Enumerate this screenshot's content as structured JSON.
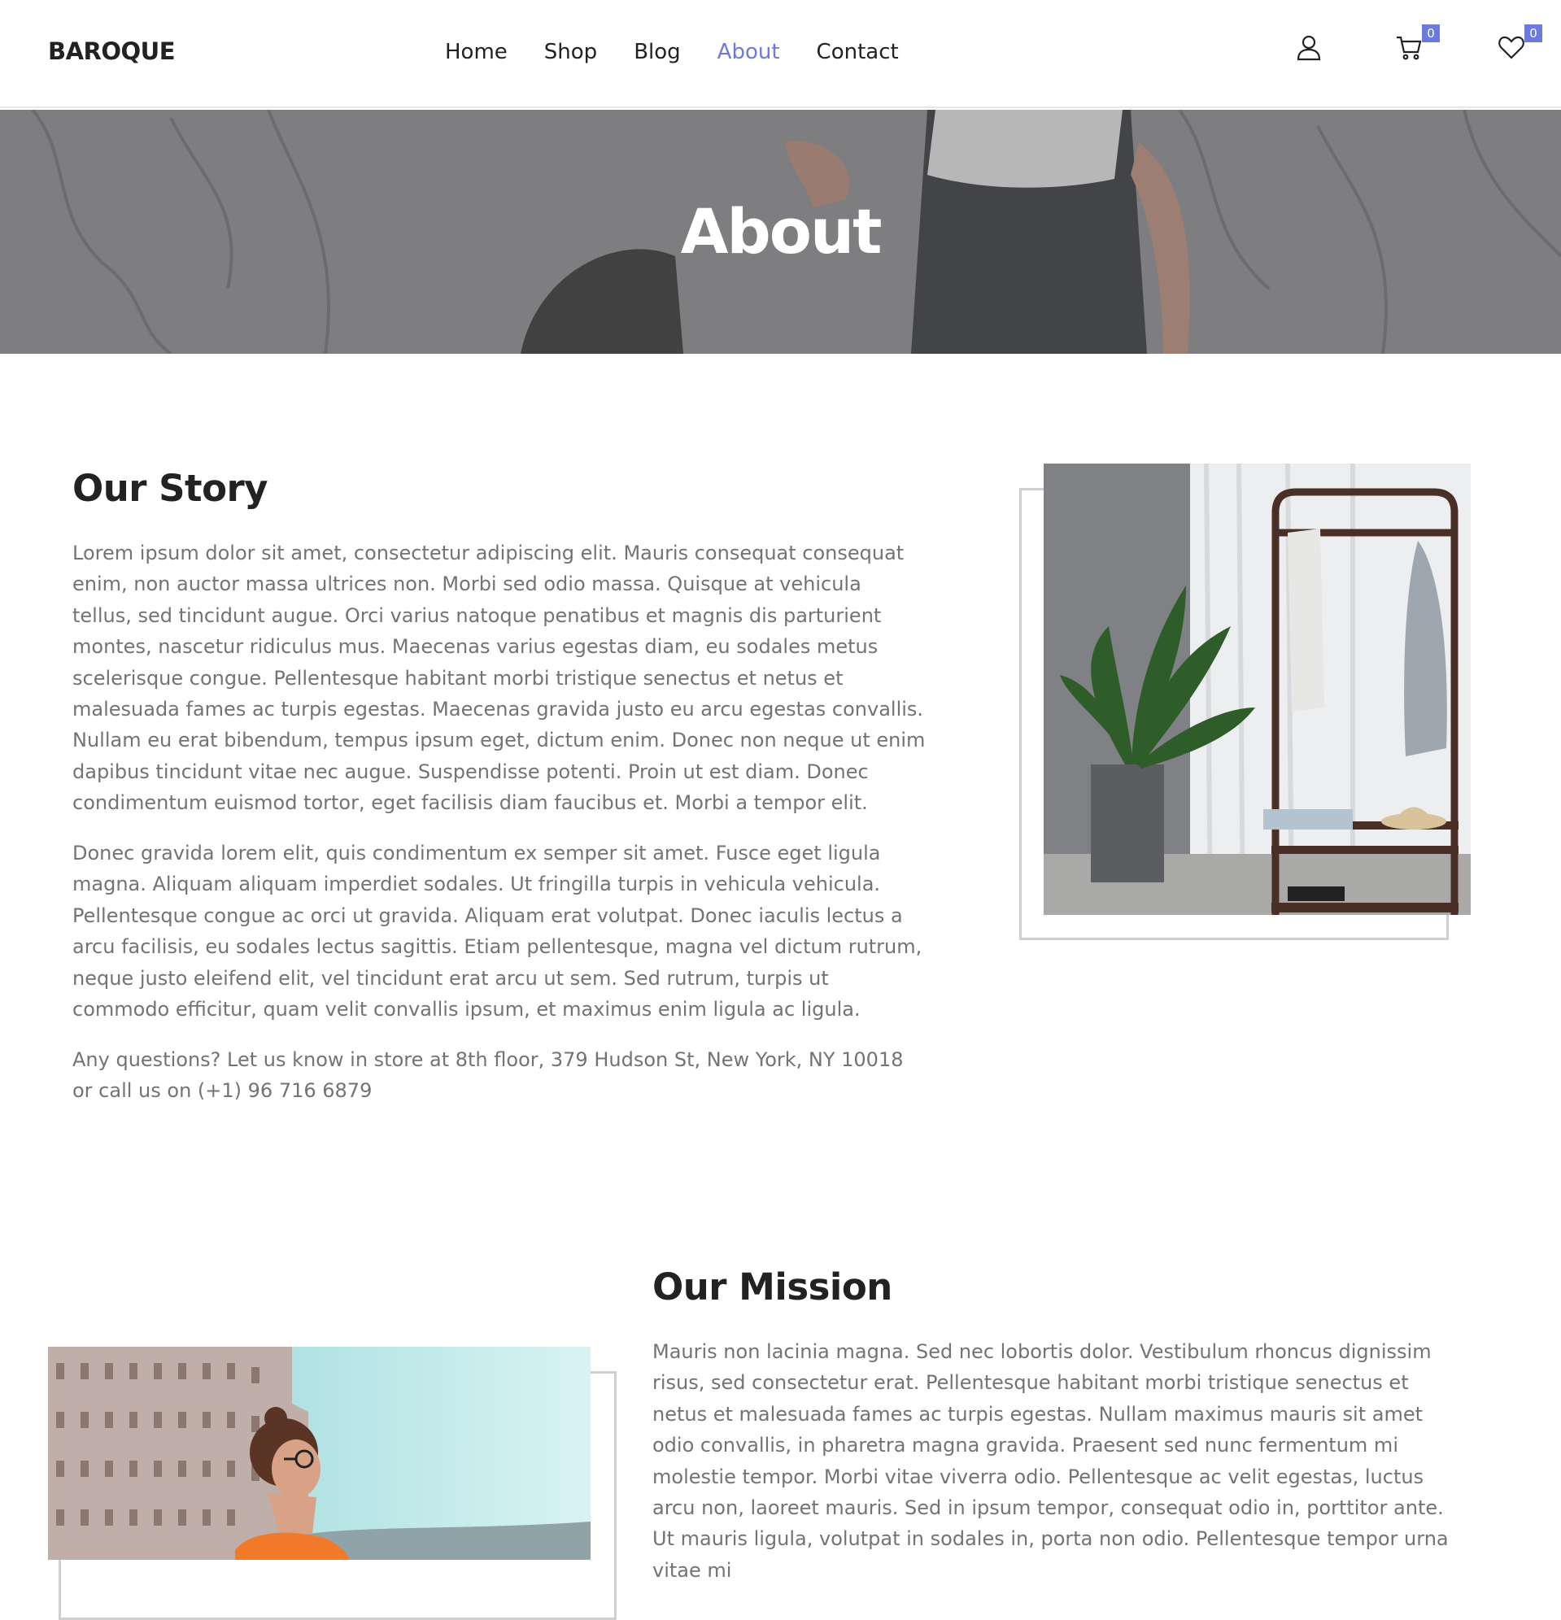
{
  "header": {
    "logo": "BAROQUE",
    "nav": [
      {
        "label": "Home",
        "active": false
      },
      {
        "label": "Shop",
        "active": false
      },
      {
        "label": "Blog",
        "active": false
      },
      {
        "label": "About",
        "active": true
      },
      {
        "label": "Contact",
        "active": false
      }
    ],
    "icons": {
      "account": "user-icon",
      "cart": "cart-icon",
      "wishlist": "heart-icon"
    },
    "cart_count": "0",
    "wishlist_count": "0"
  },
  "banner": {
    "title": "About"
  },
  "story": {
    "heading": "Our Story",
    "paragraphs": [
      "Lorem ipsum dolor sit amet, consectetur adipiscing elit. Mauris consequat consequat enim, non auctor massa ultrices non. Morbi sed odio massa. Quisque at vehicula tellus, sed tincidunt augue. Orci varius natoque penatibus et magnis dis parturient montes, nascetur ridiculus mus. Maecenas varius egestas diam, eu sodales metus scelerisque congue. Pellentesque habitant morbi tristique senectus et netus et malesuada fames ac turpis egestas. Maecenas gravida justo eu arcu egestas convallis. Nullam eu erat bibendum, tempus ipsum eget, dictum enim. Donec non neque ut enim dapibus tincidunt vitae nec augue. Suspendisse potenti. Proin ut est diam. Donec condimentum euismod tortor, eget facilisis diam faucibus et. Morbi a tempor elit.",
      "Donec gravida lorem elit, quis condimentum ex semper sit amet. Fusce eget ligula magna. Aliquam aliquam imperdiet sodales. Ut fringilla turpis in vehicula vehicula. Pellentesque congue ac orci ut gravida. Aliquam erat volutpat. Donec iaculis lectus a arcu facilisis, eu sodales lectus sagittis. Etiam pellentesque, magna vel dictum rutrum, neque justo eleifend elit, vel tincidunt erat arcu ut sem. Sed rutrum, turpis ut commodo efficitur, quam velit convallis ipsum, et maximus enim ligula ac ligula.",
      "Any questions? Let us know in store at 8th floor, 379 Hudson St, New York, NY 10018 or call us on (+1) 96 716 6879"
    ]
  },
  "mission": {
    "heading": "Our Mission",
    "paragraphs": [
      "Mauris non lacinia magna. Sed nec lobortis dolor. Vestibulum rhoncus dignissim risus, sed consectetur erat. Pellentesque habitant morbi tristique senectus et netus et malesuada fames ac turpis egestas. Nullam maximus mauris sit amet odio convallis, in pharetra magna gravida. Praesent sed nunc fermentum mi molestie tempor. Morbi vitae viverra odio. Pellentesque ac velit egestas, luctus arcu non, laoreet mauris. Sed in ipsum tempor, consequat odio in, porttitor ante. Ut mauris ligula, volutpat in sodales in, porta non odio. Pellentesque tempor urna vitae mi"
    ]
  },
  "colors": {
    "accent": "#6c7ae0",
    "text": "#222222",
    "body_text": "#737373"
  }
}
